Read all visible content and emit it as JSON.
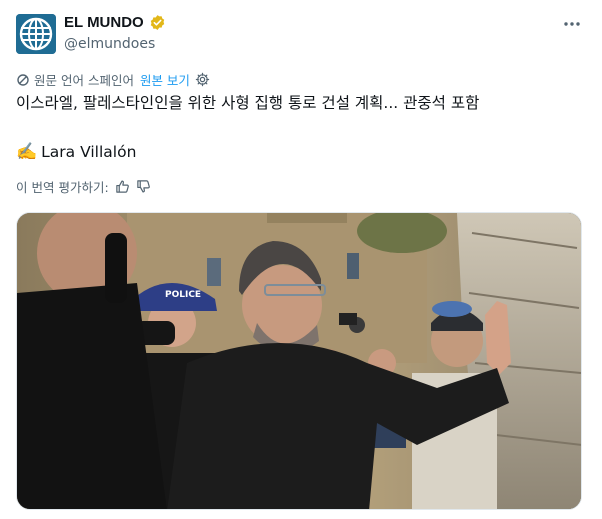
{
  "account": {
    "name": "EL MUNDO",
    "handle": "@elmundoes",
    "verified": true,
    "avatar_icon": "globe-logo-icon",
    "badge_color": "#e2b719",
    "avatar_color": "#1f6c94"
  },
  "menu": {
    "icon": "more-options-icon"
  },
  "translation": {
    "label": "원문 언어 스페인어",
    "show_original": "원본 보기",
    "link_color": "#1d9bf0"
  },
  "tweet": {
    "text": "이스라엘, 팔레스타인인을 위한 사형 집행 통로 건설 계획... 관중석 포함",
    "author_emoji": "✍️",
    "author": "Lara Villalón"
  },
  "rating": {
    "label": "이 번역 평가하기:"
  },
  "photo": {
    "cap_text": "POLICE",
    "icon": "news-photo"
  }
}
